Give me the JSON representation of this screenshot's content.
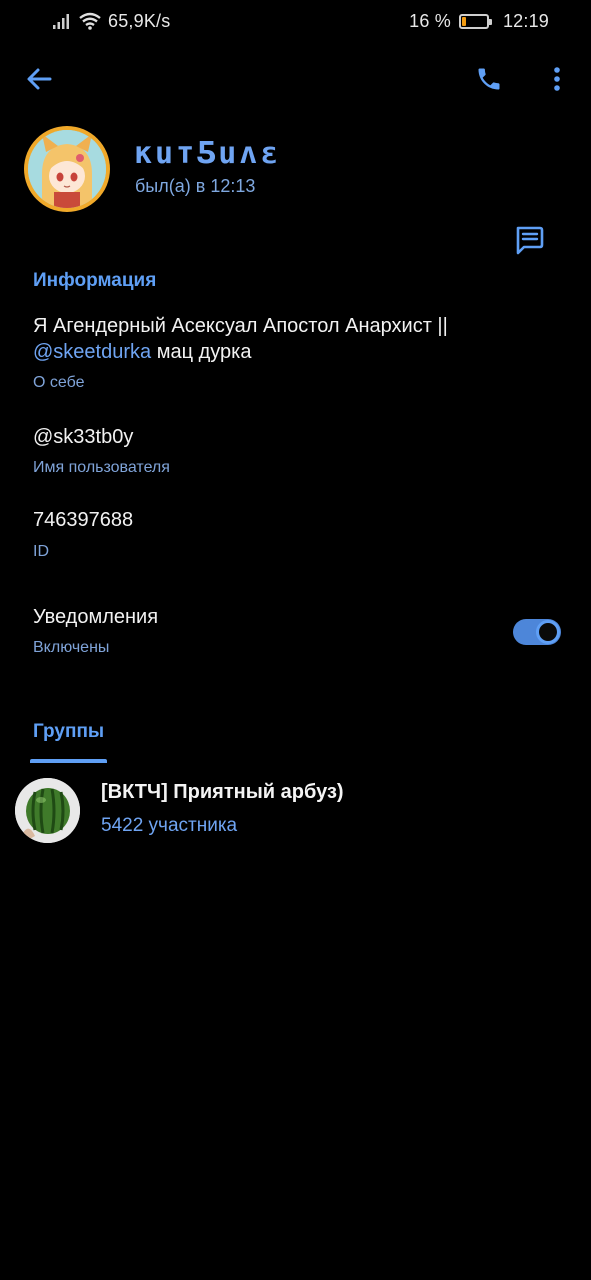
{
  "status_bar": {
    "net_speed": "65,9K/s",
    "battery_percent": "16 %",
    "battery_level": 0.16,
    "time": "12:19"
  },
  "toolbar": {
    "back_icon": "arrow-left-icon",
    "call_icon": "phone-icon",
    "menu_icon": "more-vertical-icon"
  },
  "profile": {
    "name": "ĸuтƼuʌɛ",
    "last_seen": "был(а) в 12:13",
    "message_icon": "chat-bubble-icon"
  },
  "info": {
    "section_title": "Информация",
    "bio_text_1": "Я Агендерный Асексуал Апостол Анархист ||",
    "bio_link": "@skeetdurka",
    "bio_text_2": " мац дурка",
    "bio_label": "О себе",
    "username": "@sk33tb0y",
    "username_label": "Имя пользователя",
    "id": "746397688",
    "id_label": "ID",
    "notifications_title": "Уведомления",
    "notifications_state": "Включены",
    "notifications_on": true
  },
  "groups": {
    "tab_label": "Группы",
    "items": [
      {
        "name": "[ВКТЧ] Приятный арбуз)",
        "members": "5422 участника"
      }
    ]
  },
  "colors": {
    "accent": "#5f9ff5",
    "background": "#000000"
  }
}
